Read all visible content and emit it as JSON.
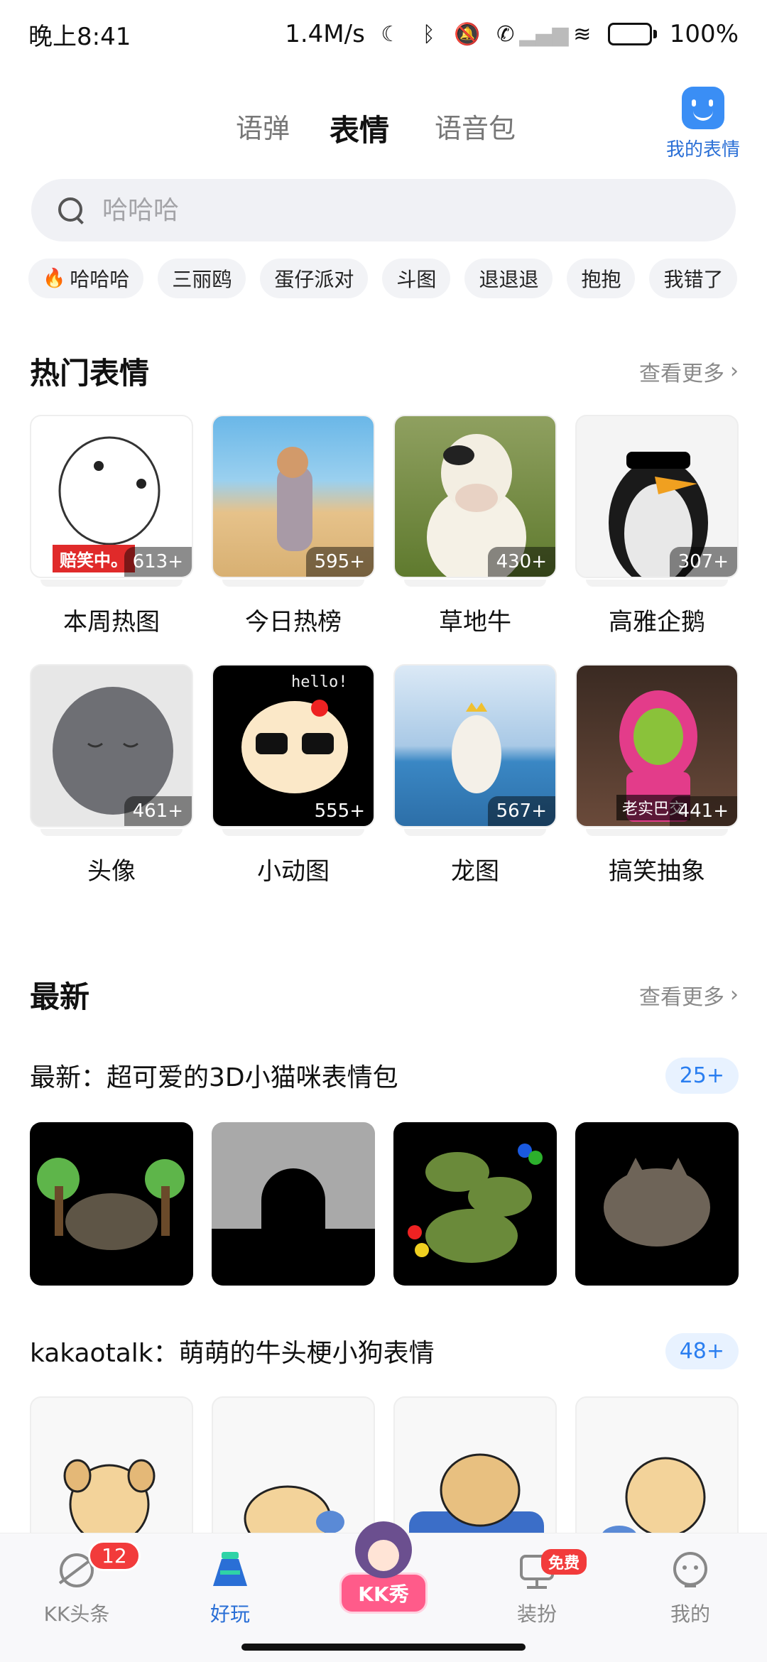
{
  "status_bar": {
    "time": "晚上8:41",
    "speed": "1.4M/s",
    "battery": "100%",
    "icons": [
      "moon-icon",
      "bluetooth-icon",
      "mute-icon",
      "call-icon",
      "signal-icon",
      "wifi-icon",
      "battery-icon"
    ]
  },
  "tabs": [
    {
      "label": "语弹",
      "active": false
    },
    {
      "label": "表情",
      "active": true
    },
    {
      "label": "语音包",
      "active": false
    }
  ],
  "my_emoji": {
    "label": "我的表情"
  },
  "search": {
    "placeholder": "哈哈哈"
  },
  "chips": [
    "哈哈哈",
    "三丽鸥",
    "蛋仔派对",
    "斗图",
    "退退退",
    "抱抱",
    "我错了"
  ],
  "hot": {
    "title": "热门表情",
    "more": "查看更多",
    "items": [
      {
        "name": "本周热图",
        "count": "613+",
        "tag": "赔笑中。"
      },
      {
        "name": "今日热榜",
        "count": "595+"
      },
      {
        "name": "草地牛",
        "count": "430+"
      },
      {
        "name": "高雅企鹅",
        "count": "307+"
      },
      {
        "name": "头像",
        "count": "461+"
      },
      {
        "name": "小动图",
        "count": "555+",
        "overlay_text": "hello!"
      },
      {
        "name": "龙图",
        "count": "567+"
      },
      {
        "name": "搞笑抽象",
        "count": "441+",
        "tag": "老实巴交"
      }
    ]
  },
  "latest": {
    "title": "最新",
    "more": "查看更多",
    "packs": [
      {
        "title": "最新：超可爱的3D小猫咪表情包",
        "count": "25+"
      },
      {
        "title": "kakaotalk：萌萌的牛头梗小狗表情",
        "count": "48+"
      }
    ]
  },
  "tabbar": {
    "items": [
      {
        "label": "KK头条",
        "badge": "12"
      },
      {
        "label": "好玩",
        "active": true
      },
      {
        "label": "KK秀"
      },
      {
        "label": "装扮",
        "badge": "免费"
      },
      {
        "label": "我的"
      }
    ]
  },
  "colors": {
    "accent": "#2a6fd6",
    "highlight": "#ffd53a",
    "badge": "#f23b3b"
  }
}
